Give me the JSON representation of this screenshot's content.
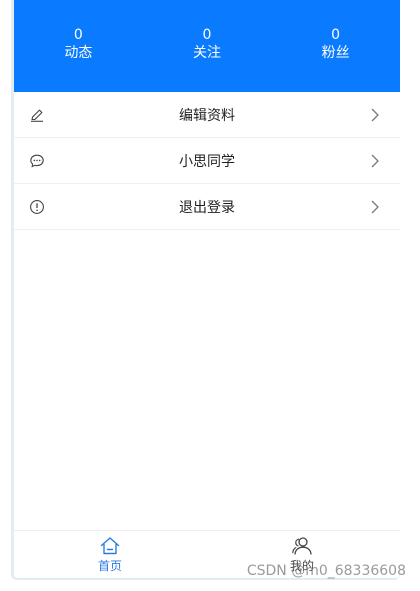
{
  "stats": [
    {
      "value": "0",
      "label": "动态"
    },
    {
      "value": "0",
      "label": "关注"
    },
    {
      "value": "0",
      "label": "粉丝"
    }
  ],
  "menu": [
    {
      "label": "编辑资料",
      "icon": "edit-icon"
    },
    {
      "label": "小思同学",
      "icon": "chat-icon"
    },
    {
      "label": "退出登录",
      "icon": "exclamation-circle-icon"
    }
  ],
  "tabbar": {
    "home": {
      "label": "首页",
      "icon": "home-icon"
    },
    "me": {
      "label": "我的",
      "icon": "user-icon"
    }
  },
  "watermark": "CSDN @m0_68336608",
  "colors": {
    "header": "#0a7bff",
    "active_tab": "#2a7ce0"
  }
}
